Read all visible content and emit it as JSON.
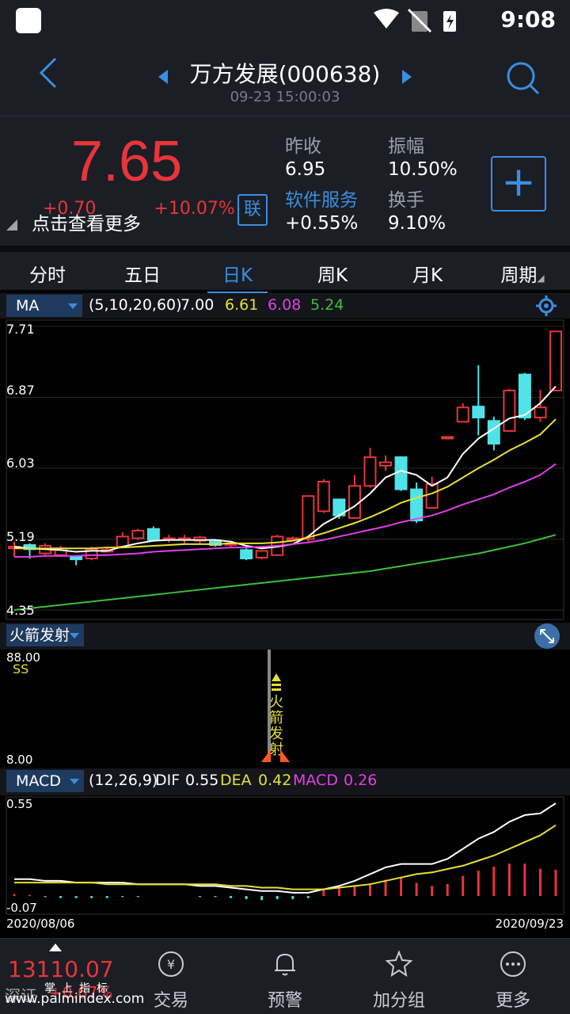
{
  "status_bar": {
    "time": "9:08"
  },
  "header": {
    "title": "万方发展(000638)",
    "subtitle": "09-23 15:00:03"
  },
  "quote": {
    "price": "7.65",
    "change": "+0.70",
    "change_pct": "+10.07%",
    "more_link": "点击查看更多",
    "lian_badge": "联",
    "prev_close_label": "昨收",
    "prev_close": "6.95",
    "amplitude_label": "振幅",
    "amplitude": "10.50%",
    "sector_label": "软件服务",
    "sector_change": "+0.55%",
    "turnover_label": "换手",
    "turnover": "9.10%",
    "add_button": "+"
  },
  "tabs": [
    {
      "label": "分时"
    },
    {
      "label": "五日"
    },
    {
      "label": "日K"
    },
    {
      "label": "周K"
    },
    {
      "label": "月K"
    },
    {
      "label": "周期"
    }
  ],
  "ma_panel": {
    "indicator": "MA",
    "params": "(5,10,20,60)",
    "ma5": "7.00",
    "ma10": "6.61",
    "ma20": "6.08",
    "ma60": "5.24",
    "y_ticks": [
      "7.71",
      "6.87",
      "6.03",
      "5.19",
      "4.35"
    ],
    "colors": {
      "up": "#e8353b",
      "down": "#4fe3e8",
      "ma5": "#ffffff",
      "ma10": "#e6e035",
      "ma20": "#e040e8",
      "ma60": "#3cbf3c"
    }
  },
  "rocket_panel": {
    "indicator": "火箭发射",
    "ss_label": "SS",
    "y_top": "88.00",
    "y_bottom": "8.00",
    "signal_text": "火箭发射"
  },
  "macd_panel": {
    "indicator": "MACD",
    "params": "(12,26,9)",
    "dif_label": "DIF",
    "dif": "0.55",
    "dea_label": "DEA",
    "dea": "0.42",
    "macd_label": "MACD",
    "macd": "0.26",
    "y_top": "0.55",
    "y_bottom": "-0.07",
    "date_start": "2020/08/06",
    "date_end": "2020/09/23"
  },
  "bottom_nav": {
    "index_value": "13110.07",
    "index_name": "深证",
    "index_change": "+0.67%",
    "brand": "掌上指标",
    "watermark": "www.palmindex.com",
    "items": [
      {
        "label": "交易",
        "icon": "yuan-exchange-icon"
      },
      {
        "label": "预警",
        "icon": "bell-icon"
      },
      {
        "label": "加分组",
        "icon": "star-icon"
      },
      {
        "label": "更多",
        "icon": "more-icon"
      }
    ]
  },
  "chart_data": [
    {
      "type": "candlestick",
      "title": "",
      "ylim": [
        4.35,
        7.71
      ],
      "y_ticks": [
        7.71,
        6.87,
        6.03,
        5.19,
        4.35
      ],
      "x_range": [
        "2020/08/06",
        "2020/09/23"
      ],
      "candles": [
        {
          "o": 5.08,
          "c": 5.1,
          "h": 5.16,
          "l": 4.98
        },
        {
          "o": 5.12,
          "c": 5.07,
          "h": 5.14,
          "l": 4.96
        },
        {
          "o": 5.02,
          "c": 5.11,
          "h": 5.14,
          "l": 5.0
        },
        {
          "o": 5.0,
          "c": 5.08,
          "h": 5.11,
          "l": 4.98
        },
        {
          "o": 4.98,
          "c": 4.95,
          "h": 5.0,
          "l": 4.88
        },
        {
          "o": 4.96,
          "c": 5.07,
          "h": 5.1,
          "l": 4.94
        },
        {
          "o": 5.05,
          "c": 5.06,
          "h": 5.09,
          "l": 5.03
        },
        {
          "o": 5.1,
          "c": 5.22,
          "h": 5.27,
          "l": 5.09
        },
        {
          "o": 5.2,
          "c": 5.29,
          "h": 5.31,
          "l": 5.18
        },
        {
          "o": 5.31,
          "c": 5.18,
          "h": 5.34,
          "l": 5.16
        },
        {
          "o": 5.2,
          "c": 5.2,
          "h": 5.24,
          "l": 5.15
        },
        {
          "o": 5.2,
          "c": 5.2,
          "h": 5.24,
          "l": 5.14
        },
        {
          "o": 5.17,
          "c": 5.21,
          "h": 5.23,
          "l": 5.13
        },
        {
          "o": 5.16,
          "c": 5.12,
          "h": 5.19,
          "l": 5.1
        },
        {
          "o": 5.14,
          "c": 5.14,
          "h": 5.17,
          "l": 5.1
        },
        {
          "o": 5.06,
          "c": 4.96,
          "h": 5.08,
          "l": 4.94
        },
        {
          "o": 4.97,
          "c": 5.05,
          "h": 5.06,
          "l": 4.95
        },
        {
          "o": 5.0,
          "c": 5.22,
          "h": 5.24,
          "l": 4.99
        },
        {
          "o": 5.18,
          "c": 5.2,
          "h": 5.22,
          "l": 5.17
        },
        {
          "o": 5.19,
          "c": 5.7,
          "h": 5.71,
          "l": 5.15
        },
        {
          "o": 5.52,
          "c": 5.87,
          "h": 5.9,
          "l": 5.5
        },
        {
          "o": 5.66,
          "c": 5.47,
          "h": 5.67,
          "l": 5.43
        },
        {
          "o": 5.44,
          "c": 5.82,
          "h": 5.95,
          "l": 5.43
        },
        {
          "o": 5.82,
          "c": 6.16,
          "h": 6.27,
          "l": 5.8
        },
        {
          "o": 6.06,
          "c": 6.1,
          "h": 6.18,
          "l": 6.0
        },
        {
          "o": 6.16,
          "c": 5.78,
          "h": 6.17,
          "l": 5.76
        },
        {
          "o": 5.78,
          "c": 5.41,
          "h": 5.86,
          "l": 5.38
        },
        {
          "o": 5.56,
          "c": 5.84,
          "h": 5.93,
          "l": 5.55
        },
        {
          "o": 6.4,
          "c": 6.4,
          "h": 6.4,
          "l": 6.4
        },
        {
          "o": 6.58,
          "c": 6.75,
          "h": 6.8,
          "l": 6.58
        },
        {
          "o": 6.76,
          "c": 6.63,
          "h": 7.25,
          "l": 6.42
        },
        {
          "o": 6.59,
          "c": 6.32,
          "h": 6.64,
          "l": 6.24
        },
        {
          "o": 6.47,
          "c": 6.95,
          "h": 6.97,
          "l": 6.47
        },
        {
          "o": 7.14,
          "c": 6.63,
          "h": 7.16,
          "l": 6.6
        },
        {
          "o": 6.63,
          "c": 6.75,
          "h": 6.96,
          "l": 6.58
        },
        {
          "o": 6.95,
          "c": 7.65,
          "h": 7.65,
          "l": 6.95
        }
      ],
      "series": [
        {
          "name": "MA5",
          "values": [
            5.1,
            5.08,
            5.07,
            5.06,
            5.04,
            5.05,
            5.05,
            5.1,
            5.14,
            5.17,
            5.18,
            5.18,
            5.18,
            5.18,
            5.16,
            5.11,
            5.08,
            5.1,
            5.13,
            5.22,
            5.37,
            5.47,
            5.58,
            5.73,
            5.92,
            6.0,
            5.95,
            5.82,
            5.92,
            6.2,
            6.38,
            6.5,
            6.62,
            6.66,
            6.8,
            7.0
          ]
        },
        {
          "name": "MA10",
          "values": [
            5.08,
            5.08,
            5.08,
            5.08,
            5.08,
            5.08,
            5.09,
            5.09,
            5.1,
            5.11,
            5.12,
            5.13,
            5.13,
            5.13,
            5.14,
            5.14,
            5.14,
            5.15,
            5.17,
            5.21,
            5.26,
            5.32,
            5.38,
            5.45,
            5.53,
            5.62,
            5.68,
            5.73,
            5.81,
            5.92,
            6.03,
            6.13,
            6.24,
            6.33,
            6.43,
            6.61
          ]
        },
        {
          "name": "MA20",
          "values": [
            4.98,
            4.98,
            4.99,
            4.99,
            4.99,
            5.0,
            5.0,
            5.01,
            5.02,
            5.04,
            5.05,
            5.06,
            5.07,
            5.08,
            5.09,
            5.09,
            5.1,
            5.11,
            5.13,
            5.15,
            5.18,
            5.22,
            5.26,
            5.3,
            5.34,
            5.39,
            5.43,
            5.47,
            5.53,
            5.6,
            5.66,
            5.72,
            5.8,
            5.87,
            5.95,
            6.08
          ]
        },
        {
          "name": "MA60",
          "values": [
            4.35,
            4.37,
            4.39,
            4.41,
            4.43,
            4.45,
            4.47,
            4.49,
            4.51,
            4.53,
            4.55,
            4.57,
            4.59,
            4.61,
            4.63,
            4.65,
            4.67,
            4.69,
            4.71,
            4.73,
            4.75,
            4.77,
            4.79,
            4.81,
            4.84,
            4.87,
            4.9,
            4.93,
            4.96,
            4.99,
            5.02,
            5.06,
            5.1,
            5.14,
            5.19,
            5.24
          ]
        }
      ]
    },
    {
      "type": "bar",
      "title": "",
      "ylim": [
        -0.07,
        0.55
      ],
      "series": [
        {
          "name": "DIF",
          "values": [
            0.1,
            0.1,
            0.09,
            0.09,
            0.08,
            0.08,
            0.08,
            0.08,
            0.07,
            0.07,
            0.07,
            0.07,
            0.06,
            0.06,
            0.05,
            0.04,
            0.03,
            0.03,
            0.02,
            0.02,
            0.04,
            0.06,
            0.09,
            0.13,
            0.17,
            0.19,
            0.19,
            0.19,
            0.22,
            0.28,
            0.34,
            0.38,
            0.44,
            0.48,
            0.49,
            0.55
          ]
        },
        {
          "name": "DEA",
          "values": [
            0.08,
            0.08,
            0.08,
            0.08,
            0.08,
            0.08,
            0.07,
            0.07,
            0.07,
            0.07,
            0.07,
            0.07,
            0.07,
            0.07,
            0.06,
            0.06,
            0.05,
            0.05,
            0.04,
            0.04,
            0.04,
            0.05,
            0.06,
            0.07,
            0.09,
            0.11,
            0.13,
            0.14,
            0.16,
            0.18,
            0.21,
            0.24,
            0.28,
            0.32,
            0.36,
            0.42
          ]
        },
        {
          "name": "MACD",
          "values": [
            0.02,
            0.01,
            -0.01,
            -0.02,
            -0.02,
            -0.02,
            -0.02,
            -0.01,
            -0.01,
            0.0,
            0.0,
            0.0,
            -0.01,
            -0.01,
            -0.02,
            -0.03,
            -0.04,
            -0.03,
            -0.03,
            -0.02,
            0.06,
            0.09,
            0.1,
            0.12,
            0.16,
            0.18,
            0.13,
            0.1,
            0.12,
            0.2,
            0.25,
            0.29,
            0.32,
            0.32,
            0.27,
            0.26
          ]
        }
      ]
    }
  ]
}
